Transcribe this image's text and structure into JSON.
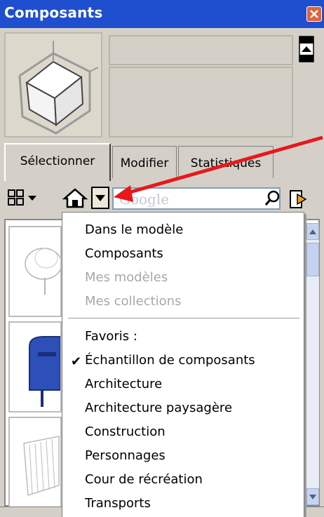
{
  "window": {
    "title": "Composants"
  },
  "tabs": [
    {
      "label": "Sélectionner",
      "active": true
    },
    {
      "label": "Modifier",
      "active": false
    },
    {
      "label": "Statistiques",
      "active": false
    }
  ],
  "search": {
    "placeholder": "Google"
  },
  "menu": {
    "items": [
      {
        "label": "Dans le modèle",
        "enabled": true
      },
      {
        "label": "Composants",
        "enabled": true
      },
      {
        "label": "Mes modèles",
        "enabled": false
      },
      {
        "label": "Mes collections",
        "enabled": false
      }
    ],
    "favorites_header": "Favoris :",
    "favorites": [
      {
        "label": "Échantillon de composants",
        "checked": true
      },
      {
        "label": "Architecture",
        "checked": false
      },
      {
        "label": "Architecture paysagère",
        "checked": false
      },
      {
        "label": "Construction",
        "checked": false
      },
      {
        "label": "Personnages",
        "checked": false
      },
      {
        "label": "Cour de récréation",
        "checked": false
      },
      {
        "label": "Transports",
        "checked": false
      }
    ]
  },
  "colors": {
    "titlebar": "#1f4fcf",
    "arrow": "#e8181c",
    "window_bg": "#d4d0c8"
  }
}
